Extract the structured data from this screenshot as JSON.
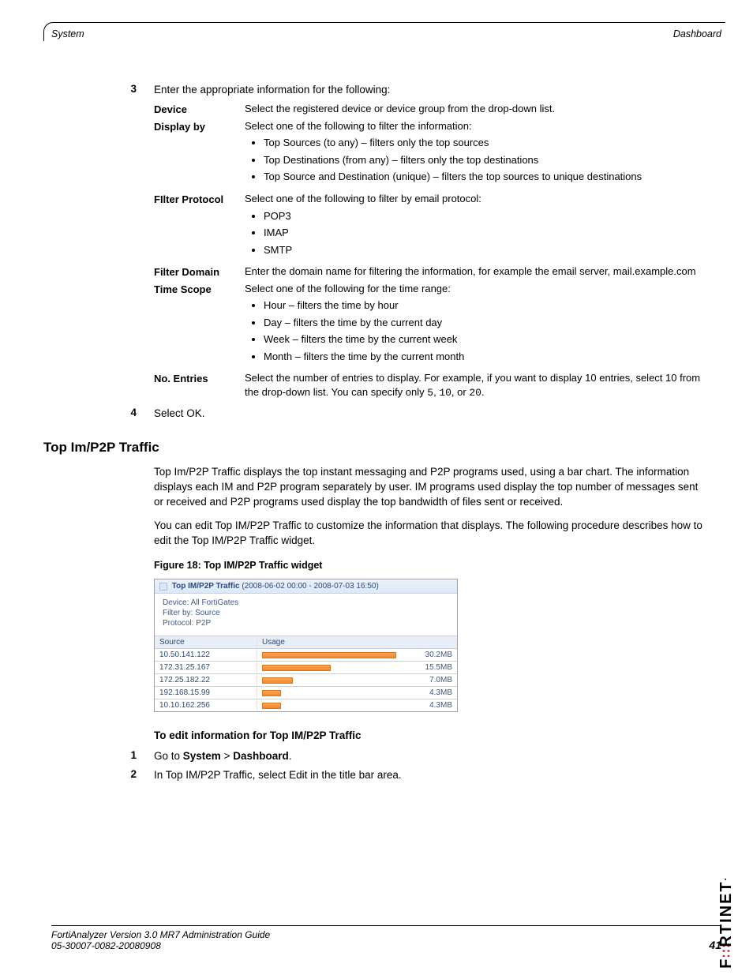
{
  "header": {
    "left": "System",
    "right": "Dashboard"
  },
  "steps_a": [
    {
      "num": "3",
      "text": "Enter the appropriate information for the following:"
    }
  ],
  "definitions": [
    {
      "label": "Device",
      "body": "Select the registered device or device group from the drop-down list.",
      "bullets": []
    },
    {
      "label": "Display by",
      "body": "Select one of the following to filter the information:",
      "bullets": [
        "Top Sources (to any) – filters only the top sources",
        "Top Destinations (from any) – filters only the top destinations",
        "Top Source and Destination (unique) – filters the top sources to unique destinations"
      ]
    },
    {
      "label": "FIlter Protocol",
      "body": "Select one of the following to filter by email protocol:",
      "bullets": [
        "POP3",
        "IMAP",
        "SMTP"
      ]
    },
    {
      "label": "Filter Domain",
      "body": "Enter the domain name for filtering the information, for example the email server, mail.example.com",
      "bullets": []
    },
    {
      "label": "Time Scope",
      "body": "Select one of the following for the time range:",
      "bullets": [
        "Hour – filters the time by hour",
        "Day – filters the time by the current day",
        "Week – filters the time by the current week",
        "Month – filters the time by the current month"
      ]
    },
    {
      "label": "No. Entries",
      "body_pre": "Select the number of entries to display. For example, if you want to display 10 entries, select 10 from the drop-down list. You can specify only ",
      "mono": [
        "5",
        "10",
        "20"
      ],
      "body_post": "."
    }
  ],
  "steps_b": [
    {
      "num": "4",
      "text": "Select OK."
    }
  ],
  "section_title": "Top Im/P2P Traffic",
  "paragraphs": [
    "Top Im/P2P Traffic displays the top instant messaging and P2P programs used, using a bar chart. The information displays each IM and P2P program separately by user. IM programs used display the top number of messages sent or received and P2P programs used display the top bandwidth of files sent or received.",
    "You can edit Top IM/P2P Traffic to customize the information that displays. The following procedure describes how to edit the Top IM/P2P Traffic widget."
  ],
  "figure_caption": "Figure 18: Top IM/P2P Traffic widget",
  "widget": {
    "title_bold": "Top IM/P2P Traffic",
    "title_rest": " (2008-06-02 00:00 - 2008-07-03 16:50)",
    "meta": [
      "Device:   All FortiGates",
      "Filter by:  Source",
      "Protocol:  P2P"
    ],
    "columns": [
      "Source",
      "Usage"
    ]
  },
  "chart_data": {
    "type": "bar",
    "title": "Top IM/P2P Traffic (2008-06-02 00:00 - 2008-07-03 16:50)",
    "xlabel": "Usage",
    "ylabel": "Source",
    "categories": [
      "10.50.141.122",
      "172.31.25.167",
      "172.25.182.22",
      "192.168.15.99",
      "10.10.162.256"
    ],
    "values": [
      30.2,
      15.5,
      7.0,
      4.3,
      4.3
    ],
    "unit": "MB",
    "value_labels": [
      "30.2MB",
      "15.5MB",
      "7.0MB",
      "4.3MB",
      "4.3MB"
    ],
    "xlim": [
      0,
      32
    ]
  },
  "proc_title": "To edit information for Top IM/P2P Traffic",
  "proc_steps": [
    {
      "num": "1",
      "pre": "Go to ",
      "b1": "System",
      "mid": " > ",
      "b2": "Dashboard",
      "post": "."
    },
    {
      "num": "2",
      "text": "In Top IM/P2P Traffic, select Edit in the title bar area."
    }
  ],
  "footer": {
    "line1": "FortiAnalyzer Version 3.0 MR7 Administration Guide",
    "line2": "05-30007-0082-20080908",
    "page": "41"
  },
  "logo": "F   RTINET"
}
